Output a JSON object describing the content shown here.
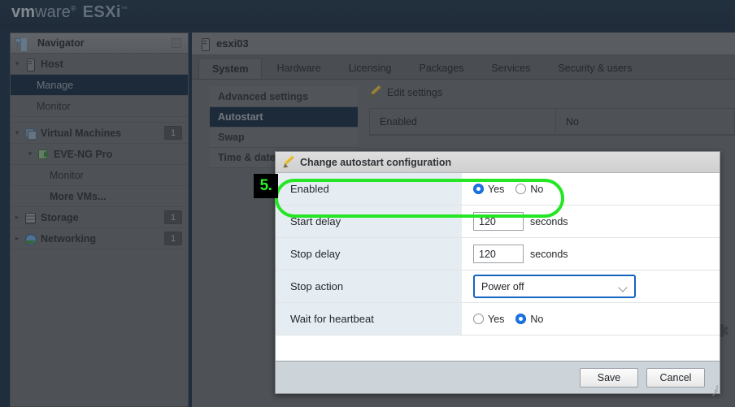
{
  "brand": {
    "vm": "vm",
    "ware": "ware",
    "reg": "®",
    "esxi": "ESXi",
    "tm": "™"
  },
  "navigator": {
    "title": "Navigator",
    "icon": "navigator-tree-icon",
    "minimize_icon": "minimize-box-icon",
    "items": [
      {
        "label": "Host",
        "icon": "host-icon",
        "caret": "▾",
        "indent": 0,
        "bold": true,
        "selected": false,
        "badge": ""
      },
      {
        "label": "Manage",
        "icon": "",
        "caret": "",
        "indent": 1,
        "bold": false,
        "selected": true,
        "badge": ""
      },
      {
        "label": "Monitor",
        "icon": "",
        "caret": "",
        "indent": 1,
        "bold": false,
        "selected": false,
        "badge": ""
      },
      {
        "label": "Virtual Machines",
        "icon": "vms-icon",
        "caret": "▾",
        "indent": 0,
        "bold": true,
        "selected": false,
        "badge": "1"
      },
      {
        "label": "EVE-NG Pro",
        "icon": "vm-green-icon",
        "caret": "▾",
        "indent": 1,
        "bold": true,
        "selected": false,
        "badge": ""
      },
      {
        "label": "Monitor",
        "icon": "",
        "caret": "",
        "indent": 2,
        "bold": false,
        "selected": false,
        "badge": ""
      },
      {
        "label": "More VMs...",
        "icon": "",
        "caret": "",
        "indent": 2,
        "bold": true,
        "selected": false,
        "badge": ""
      },
      {
        "label": "Storage",
        "icon": "storage-icon",
        "caret": "▸",
        "indent": 0,
        "bold": true,
        "selected": false,
        "badge": "1"
      },
      {
        "label": "Networking",
        "icon": "network-icon",
        "caret": "▸",
        "indent": 0,
        "bold": true,
        "selected": false,
        "badge": "1"
      }
    ]
  },
  "content": {
    "breadcrumb": "esxi03",
    "breadcrumb_icon": "host-icon",
    "tabs": [
      {
        "label": "System",
        "active": true
      },
      {
        "label": "Hardware",
        "active": false
      },
      {
        "label": "Licensing",
        "active": false
      },
      {
        "label": "Packages",
        "active": false
      },
      {
        "label": "Services",
        "active": false
      },
      {
        "label": "Security & users",
        "active": false
      }
    ],
    "submenu": [
      {
        "label": "Advanced settings",
        "selected": false
      },
      {
        "label": "Autostart",
        "selected": true
      },
      {
        "label": "Swap",
        "selected": false
      },
      {
        "label": "Time & date",
        "selected": false
      }
    ],
    "edit_settings_label": "Edit settings",
    "edit_settings_icon": "pencil-icon",
    "settings_rows": [
      {
        "key": "Enabled",
        "value": "No"
      }
    ],
    "gear_icon": "gear-icon"
  },
  "dialog": {
    "title": "Change autostart configuration",
    "title_icon": "pencil-icon",
    "rows": [
      {
        "label": "Enabled",
        "type": "radio",
        "options": [
          {
            "label": "Yes",
            "selected": true
          },
          {
            "label": "No",
            "selected": false
          }
        ]
      },
      {
        "label": "Start delay",
        "type": "text",
        "value": "120",
        "unit": "seconds"
      },
      {
        "label": "Stop delay",
        "type": "text",
        "value": "120",
        "unit": "seconds"
      },
      {
        "label": "Stop action",
        "type": "select",
        "value": "Power off",
        "focused": true
      },
      {
        "label": "Wait for heartbeat",
        "type": "radio",
        "options": [
          {
            "label": "Yes",
            "selected": false
          },
          {
            "label": "No",
            "selected": true
          }
        ]
      }
    ],
    "save_label": "Save",
    "cancel_label": "Cancel",
    "resize_grip_icon": "resize-grip-icon"
  },
  "annotation": {
    "step_number": "5.",
    "highlight_color": "#25e625",
    "badge_bg": "#000000",
    "badge_text_color": "#2bf02b",
    "highlight_target": "Enabled"
  }
}
